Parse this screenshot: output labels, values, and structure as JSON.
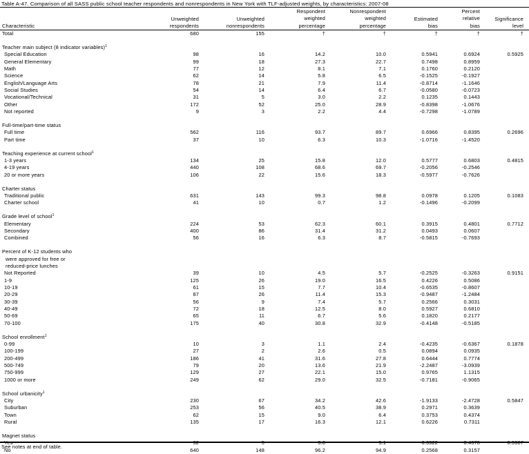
{
  "title": "Table A-47. Comparison of all SASS public school teacher respondents and nonrespondents in New York with TLF-adjusted weights, by characteristics: 2007-08",
  "columns": [
    {
      "lines": [
        "Characteristic"
      ]
    },
    {
      "lines": [
        "Unweighted",
        "respondents"
      ]
    },
    {
      "lines": [
        "Unweighted",
        "nonrespondents"
      ]
    },
    {
      "lines": [
        "Respondent",
        "weighted",
        "percentage"
      ]
    },
    {
      "lines": [
        "Nonrespondent",
        "weighted",
        "percentage"
      ]
    },
    {
      "lines": [
        "Estimated",
        "bias"
      ]
    },
    {
      "lines": [
        "Percent",
        "relative",
        "bias"
      ]
    },
    {
      "lines": [
        "Significance",
        "level"
      ]
    }
  ],
  "rows": [
    {
      "type": "total",
      "cells": [
        "Total",
        "680",
        "155",
        "†",
        "†",
        "†",
        "†",
        "†"
      ]
    },
    {
      "type": "gap"
    },
    {
      "type": "heading",
      "label": "Teacher main subject (8 indicator variables)",
      "sup": "1"
    },
    {
      "type": "item",
      "cells": [
        "Special Education",
        "98",
        "16",
        "14.2",
        "10.0",
        "0.5941",
        "0.6924",
        "0.5925"
      ]
    },
    {
      "type": "item",
      "cells": [
        "General Elementary",
        "99",
        "18",
        "27.3",
        "22.7",
        "0.7498",
        "0.8959",
        ""
      ]
    },
    {
      "type": "item",
      "cells": [
        "Math",
        "77",
        "12",
        "8.1",
        "7.1",
        "0.1760",
        "0.2120",
        ""
      ]
    },
    {
      "type": "item",
      "cells": [
        "Science",
        "62",
        "14",
        "5.8",
        "6.5",
        "-0.1525",
        "-0.1927",
        ""
      ]
    },
    {
      "type": "item",
      "cells": [
        "English/Language Arts",
        "78",
        "21",
        "7.9",
        "11.4",
        "-0.8714",
        "-1.1646",
        ""
      ]
    },
    {
      "type": "item",
      "cells": [
        "Social Studies",
        "54",
        "14",
        "6.4",
        "6.7",
        "-0.0580",
        "-0.0723",
        ""
      ]
    },
    {
      "type": "item",
      "cells": [
        "Vocational/Technical",
        "31",
        "5",
        "3.0",
        "2.2",
        "0.1235",
        "0.1443",
        ""
      ]
    },
    {
      "type": "item",
      "cells": [
        "Other",
        "172",
        "52",
        "25.0",
        "28.9",
        "-0.8398",
        "-1.0676",
        ""
      ]
    },
    {
      "type": "item",
      "cells": [
        "Not reported",
        "9",
        "3",
        "2.2",
        "4.4",
        "-0.7298",
        "-1.0789",
        ""
      ]
    },
    {
      "type": "gap"
    },
    {
      "type": "heading",
      "label": "Full-time/part-time status",
      "sup": ""
    },
    {
      "type": "item",
      "cells": [
        "Full time",
        "562",
        "116",
        "93.7",
        "89.7",
        "0.6966",
        "0.8395",
        "0.2696"
      ]
    },
    {
      "type": "item",
      "cells": [
        "Part time",
        "37",
        "10",
        "6.3",
        "10.3",
        "-1.0716",
        "-1.4520",
        ""
      ]
    },
    {
      "type": "gap"
    },
    {
      "type": "heading",
      "label": "Teaching experience at current school",
      "sup": "1"
    },
    {
      "type": "item",
      "cells": [
        "1-3 years",
        "134",
        "25",
        "15.8",
        "12.0",
        "0.5777",
        "0.6803",
        "0.4815"
      ]
    },
    {
      "type": "item",
      "cells": [
        "4-19 years",
        "440",
        "108",
        "68.6",
        "69.7",
        "-0.2056",
        "-0.2546",
        ""
      ]
    },
    {
      "type": "item",
      "cells": [
        "20 or more years",
        "106",
        "22",
        "15.6",
        "18.3",
        "-0.5977",
        "-0.7626",
        ""
      ]
    },
    {
      "type": "gap"
    },
    {
      "type": "heading",
      "label": "Charter status",
      "sup": ""
    },
    {
      "type": "item",
      "cells": [
        "Traditional public",
        "631",
        "143",
        "99.3",
        "98.8",
        "0.0978",
        "0.1205",
        "0.1083"
      ]
    },
    {
      "type": "item",
      "cells": [
        "Charter school",
        "41",
        "10",
        "0.7",
        "1.2",
        "-0.1496",
        "-0.2099",
        ""
      ]
    },
    {
      "type": "gap"
    },
    {
      "type": "heading",
      "label": "Grade level of school",
      "sup": "1"
    },
    {
      "type": "item",
      "cells": [
        "Elementary",
        "224",
        "53",
        "62.3",
        "60.1",
        "0.3915",
        "0.4801",
        "0.7712"
      ]
    },
    {
      "type": "item",
      "cells": [
        "Secondary",
        "400",
        "86",
        "31.4",
        "31.2",
        "0.0493",
        "0.0607",
        ""
      ]
    },
    {
      "type": "item",
      "cells": [
        "Combined",
        "56",
        "16",
        "6.3",
        "8.7",
        "-0.5815",
        "-0.7693",
        ""
      ]
    },
    {
      "type": "gap"
    },
    {
      "type": "heading",
      "label": "Percent of K-12 students who",
      "sup": ""
    },
    {
      "type": "subhead",
      "label": "were approved for free or"
    },
    {
      "type": "subhead",
      "label": "reduced-price lunches"
    },
    {
      "type": "item",
      "cells": [
        "Not Reported",
        "39",
        "10",
        "4.5",
        "5.7",
        "-0.2525",
        "-0.3263",
        "0.9151"
      ]
    },
    {
      "type": "item",
      "cells": [
        "1-9",
        "125",
        "26",
        "19.0",
        "16.5",
        "0.4226",
        "0.5086",
        ""
      ]
    },
    {
      "type": "item",
      "cells": [
        "10-19",
        "61",
        "15",
        "7.7",
        "10.4",
        "-0.6535",
        "-0.8607",
        ""
      ]
    },
    {
      "type": "item",
      "cells": [
        "20-29",
        "87",
        "26",
        "11.4",
        "15.3",
        "-0.9487",
        "-1.2484",
        ""
      ]
    },
    {
      "type": "item",
      "cells": [
        "30-39",
        "56",
        "9",
        "7.4",
        "5.7",
        "0.2566",
        "0.3031",
        ""
      ]
    },
    {
      "type": "item",
      "cells": [
        "40-49",
        "72",
        "18",
        "12.5",
        "8.0",
        "0.5927",
        "0.6810",
        ""
      ]
    },
    {
      "type": "item",
      "cells": [
        "50-69",
        "65",
        "11",
        "6.7",
        "5.6",
        "0.1820",
        "0.2177",
        ""
      ]
    },
    {
      "type": "item",
      "cells": [
        "70-100",
        "175",
        "40",
        "30.8",
        "32.9",
        "-0.4148",
        "-0.5185",
        ""
      ]
    },
    {
      "type": "gap"
    },
    {
      "type": "heading",
      "label": "School enrollment",
      "sup": "1"
    },
    {
      "type": "item",
      "cells": [
        "0-99",
        "10",
        "3",
        "1.1",
        "2.4",
        "-0.4235",
        "-0.6367",
        "0.1878"
      ]
    },
    {
      "type": "item",
      "cells": [
        "100-199",
        "27",
        "2",
        "2.6",
        "0.5",
        "0.0894",
        "0.0935",
        ""
      ]
    },
    {
      "type": "item",
      "cells": [
        "200-499",
        "186",
        "41",
        "31.6",
        "27.8",
        "0.6444",
        "0.7774",
        ""
      ]
    },
    {
      "type": "item",
      "cells": [
        "500-749",
        "79",
        "20",
        "13.6",
        "21.9",
        "-2.2487",
        "-3.0939",
        ""
      ]
    },
    {
      "type": "item",
      "cells": [
        "750-999",
        "129",
        "27",
        "22.1",
        "15.0",
        "0.9765",
        "1.1315",
        ""
      ]
    },
    {
      "type": "item",
      "cells": [
        "1000 or more",
        "249",
        "62",
        "29.0",
        "32.5",
        "-0.7181",
        "-0.9065",
        ""
      ]
    },
    {
      "type": "gap"
    },
    {
      "type": "heading",
      "label": "School urbanicity",
      "sup": "1"
    },
    {
      "type": "item",
      "cells": [
        "City",
        "230",
        "67",
        "34.2",
        "42.6",
        "-1.9133",
        "-2.4728",
        "0.5847"
      ]
    },
    {
      "type": "item",
      "cells": [
        "Suburban",
        "253",
        "56",
        "40.5",
        "38.9",
        "0.2971",
        "0.3639",
        ""
      ]
    },
    {
      "type": "item",
      "cells": [
        "Town",
        "62",
        "15",
        "9.0",
        "6.4",
        "0.3753",
        "0.4374",
        ""
      ]
    },
    {
      "type": "item",
      "cells": [
        "Rural",
        "135",
        "17",
        "16.3",
        "12.1",
        "0.6226",
        "0.7311",
        ""
      ]
    },
    {
      "type": "gap"
    },
    {
      "type": "heading",
      "label": "Magnet status",
      "sup": ""
    },
    {
      "type": "item",
      "cells": [
        "Yes",
        "32",
        "5",
        "3.8",
        "5.1",
        "-0.3322",
        "-0.4378",
        "0.5987"
      ]
    },
    {
      "type": "item",
      "cells": [
        "No",
        "640",
        "148",
        "96.2",
        "94.9",
        "0.2568",
        "0.3157",
        ""
      ]
    }
  ],
  "footnote": "See notes at end of table."
}
